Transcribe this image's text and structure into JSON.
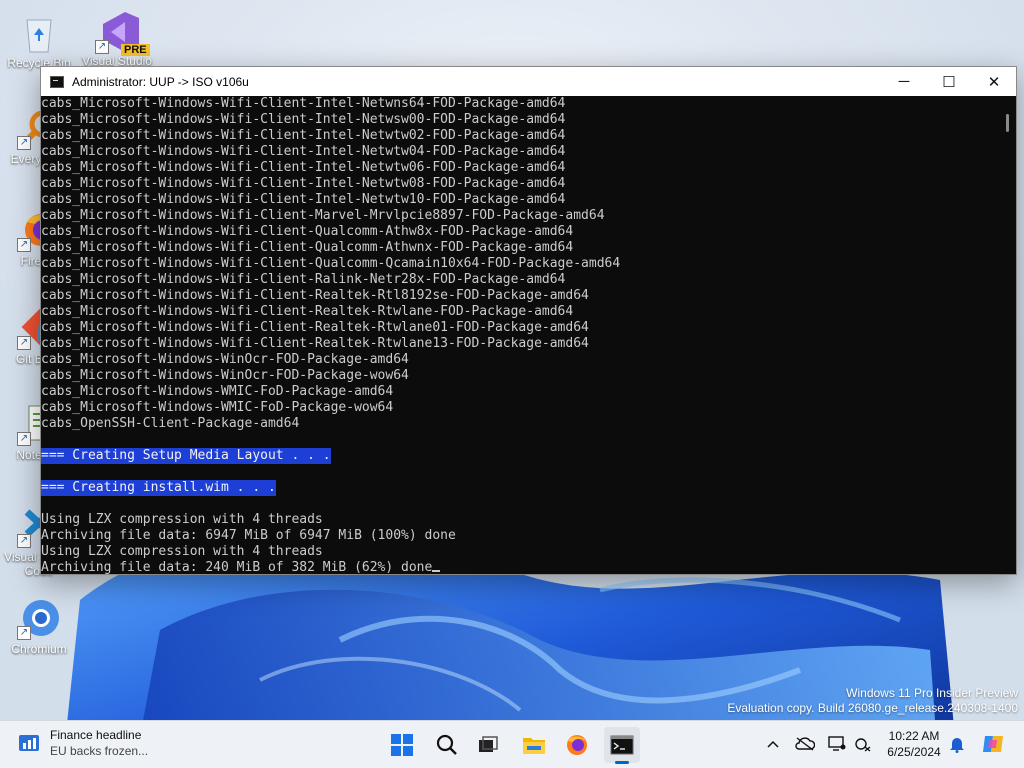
{
  "desktop": {
    "icons": [
      {
        "label": "Recycle Bin",
        "icon": "recycle-bin-icon"
      },
      {
        "label": "Visual Studio",
        "icon": "visual-studio-preview-icon",
        "badge": "PRE"
      },
      {
        "label": "Everything",
        "icon": "everything-search-icon"
      },
      {
        "label": "Firefox",
        "icon": "firefox-icon"
      },
      {
        "label": "Git Bash",
        "icon": "git-icon"
      },
      {
        "label": "Notepad",
        "icon": "notepad-icon"
      },
      {
        "label": "Visual Studio Code",
        "icon": "vscode-icon"
      },
      {
        "label": "Chromium",
        "icon": "chromium-icon"
      }
    ],
    "watermark": {
      "line1": "Windows 11 Pro Insider Preview",
      "line2": "Evaluation copy. Build 26080.ge_release.240308-1400"
    }
  },
  "window": {
    "title": "Administrator:  UUP -> ISO v106u",
    "minimize": "─",
    "maximize": "☐",
    "close": "✕",
    "console_lines": [
      {
        "text": "cabs_Microsoft-Windows-Wifi-Client-Intel-Netwns64-FOD-Package-amd64"
      },
      {
        "text": "cabs_Microsoft-Windows-Wifi-Client-Intel-Netwsw00-FOD-Package-amd64"
      },
      {
        "text": "cabs_Microsoft-Windows-Wifi-Client-Intel-Netwtw02-FOD-Package-amd64"
      },
      {
        "text": "cabs_Microsoft-Windows-Wifi-Client-Intel-Netwtw04-FOD-Package-amd64"
      },
      {
        "text": "cabs_Microsoft-Windows-Wifi-Client-Intel-Netwtw06-FOD-Package-amd64"
      },
      {
        "text": "cabs_Microsoft-Windows-Wifi-Client-Intel-Netwtw08-FOD-Package-amd64"
      },
      {
        "text": "cabs_Microsoft-Windows-Wifi-Client-Intel-Netwtw10-FOD-Package-amd64"
      },
      {
        "text": "cabs_Microsoft-Windows-Wifi-Client-Marvel-Mrvlpcie8897-FOD-Package-amd64"
      },
      {
        "text": "cabs_Microsoft-Windows-Wifi-Client-Qualcomm-Athw8x-FOD-Package-amd64"
      },
      {
        "text": "cabs_Microsoft-Windows-Wifi-Client-Qualcomm-Athwnx-FOD-Package-amd64"
      },
      {
        "text": "cabs_Microsoft-Windows-Wifi-Client-Qualcomm-Qcamain10x64-FOD-Package-amd64"
      },
      {
        "text": "cabs_Microsoft-Windows-Wifi-Client-Ralink-Netr28x-FOD-Package-amd64"
      },
      {
        "text": "cabs_Microsoft-Windows-Wifi-Client-Realtek-Rtl8192se-FOD-Package-amd64"
      },
      {
        "text": "cabs_Microsoft-Windows-Wifi-Client-Realtek-Rtwlane-FOD-Package-amd64"
      },
      {
        "text": "cabs_Microsoft-Windows-Wifi-Client-Realtek-Rtwlane01-FOD-Package-amd64"
      },
      {
        "text": "cabs_Microsoft-Windows-Wifi-Client-Realtek-Rtwlane13-FOD-Package-amd64"
      },
      {
        "text": "cabs_Microsoft-Windows-WinOcr-FOD-Package-amd64"
      },
      {
        "text": "cabs_Microsoft-Windows-WinOcr-FOD-Package-wow64"
      },
      {
        "text": "cabs_Microsoft-Windows-WMIC-FoD-Package-amd64"
      },
      {
        "text": "cabs_Microsoft-Windows-WMIC-FoD-Package-wow64"
      },
      {
        "text": "cabs_OpenSSH-Client-Package-amd64"
      },
      {
        "text": ""
      },
      {
        "text": "=== Creating Setup Media Layout . . .",
        "highlight": true
      },
      {
        "text": ""
      },
      {
        "text": "=== Creating install.wim . . .",
        "highlight": true
      },
      {
        "text": ""
      },
      {
        "text": "Using LZX compression with 4 threads"
      },
      {
        "text": "Archiving file data: 6947 MiB of 6947 MiB (100%) done"
      },
      {
        "text": "Using LZX compression with 4 threads"
      },
      {
        "text": "Archiving file data: 240 MiB of 382 MiB (62%) done",
        "cursor": true
      }
    ]
  },
  "taskbar": {
    "news": {
      "title": "Finance headline",
      "subtitle": "EU backs frozen..."
    },
    "apps": [
      {
        "name": "start-button",
        "icon": "windows-start-icon"
      },
      {
        "name": "search-button",
        "icon": "search-icon"
      },
      {
        "name": "task-view-button",
        "icon": "task-view-icon"
      },
      {
        "name": "file-explorer-button",
        "icon": "folder-icon"
      },
      {
        "name": "firefox-taskbar-button",
        "icon": "firefox-icon"
      },
      {
        "name": "terminal-taskbar-button",
        "icon": "terminal-icon",
        "active": true
      }
    ],
    "tray": [
      "chevron-up-icon",
      "onedrive-offline-icon",
      "display-icon",
      "network-icon"
    ],
    "clock": {
      "time": "10:22 AM",
      "date": "6/25/2024"
    },
    "accent": "#0067c0"
  }
}
